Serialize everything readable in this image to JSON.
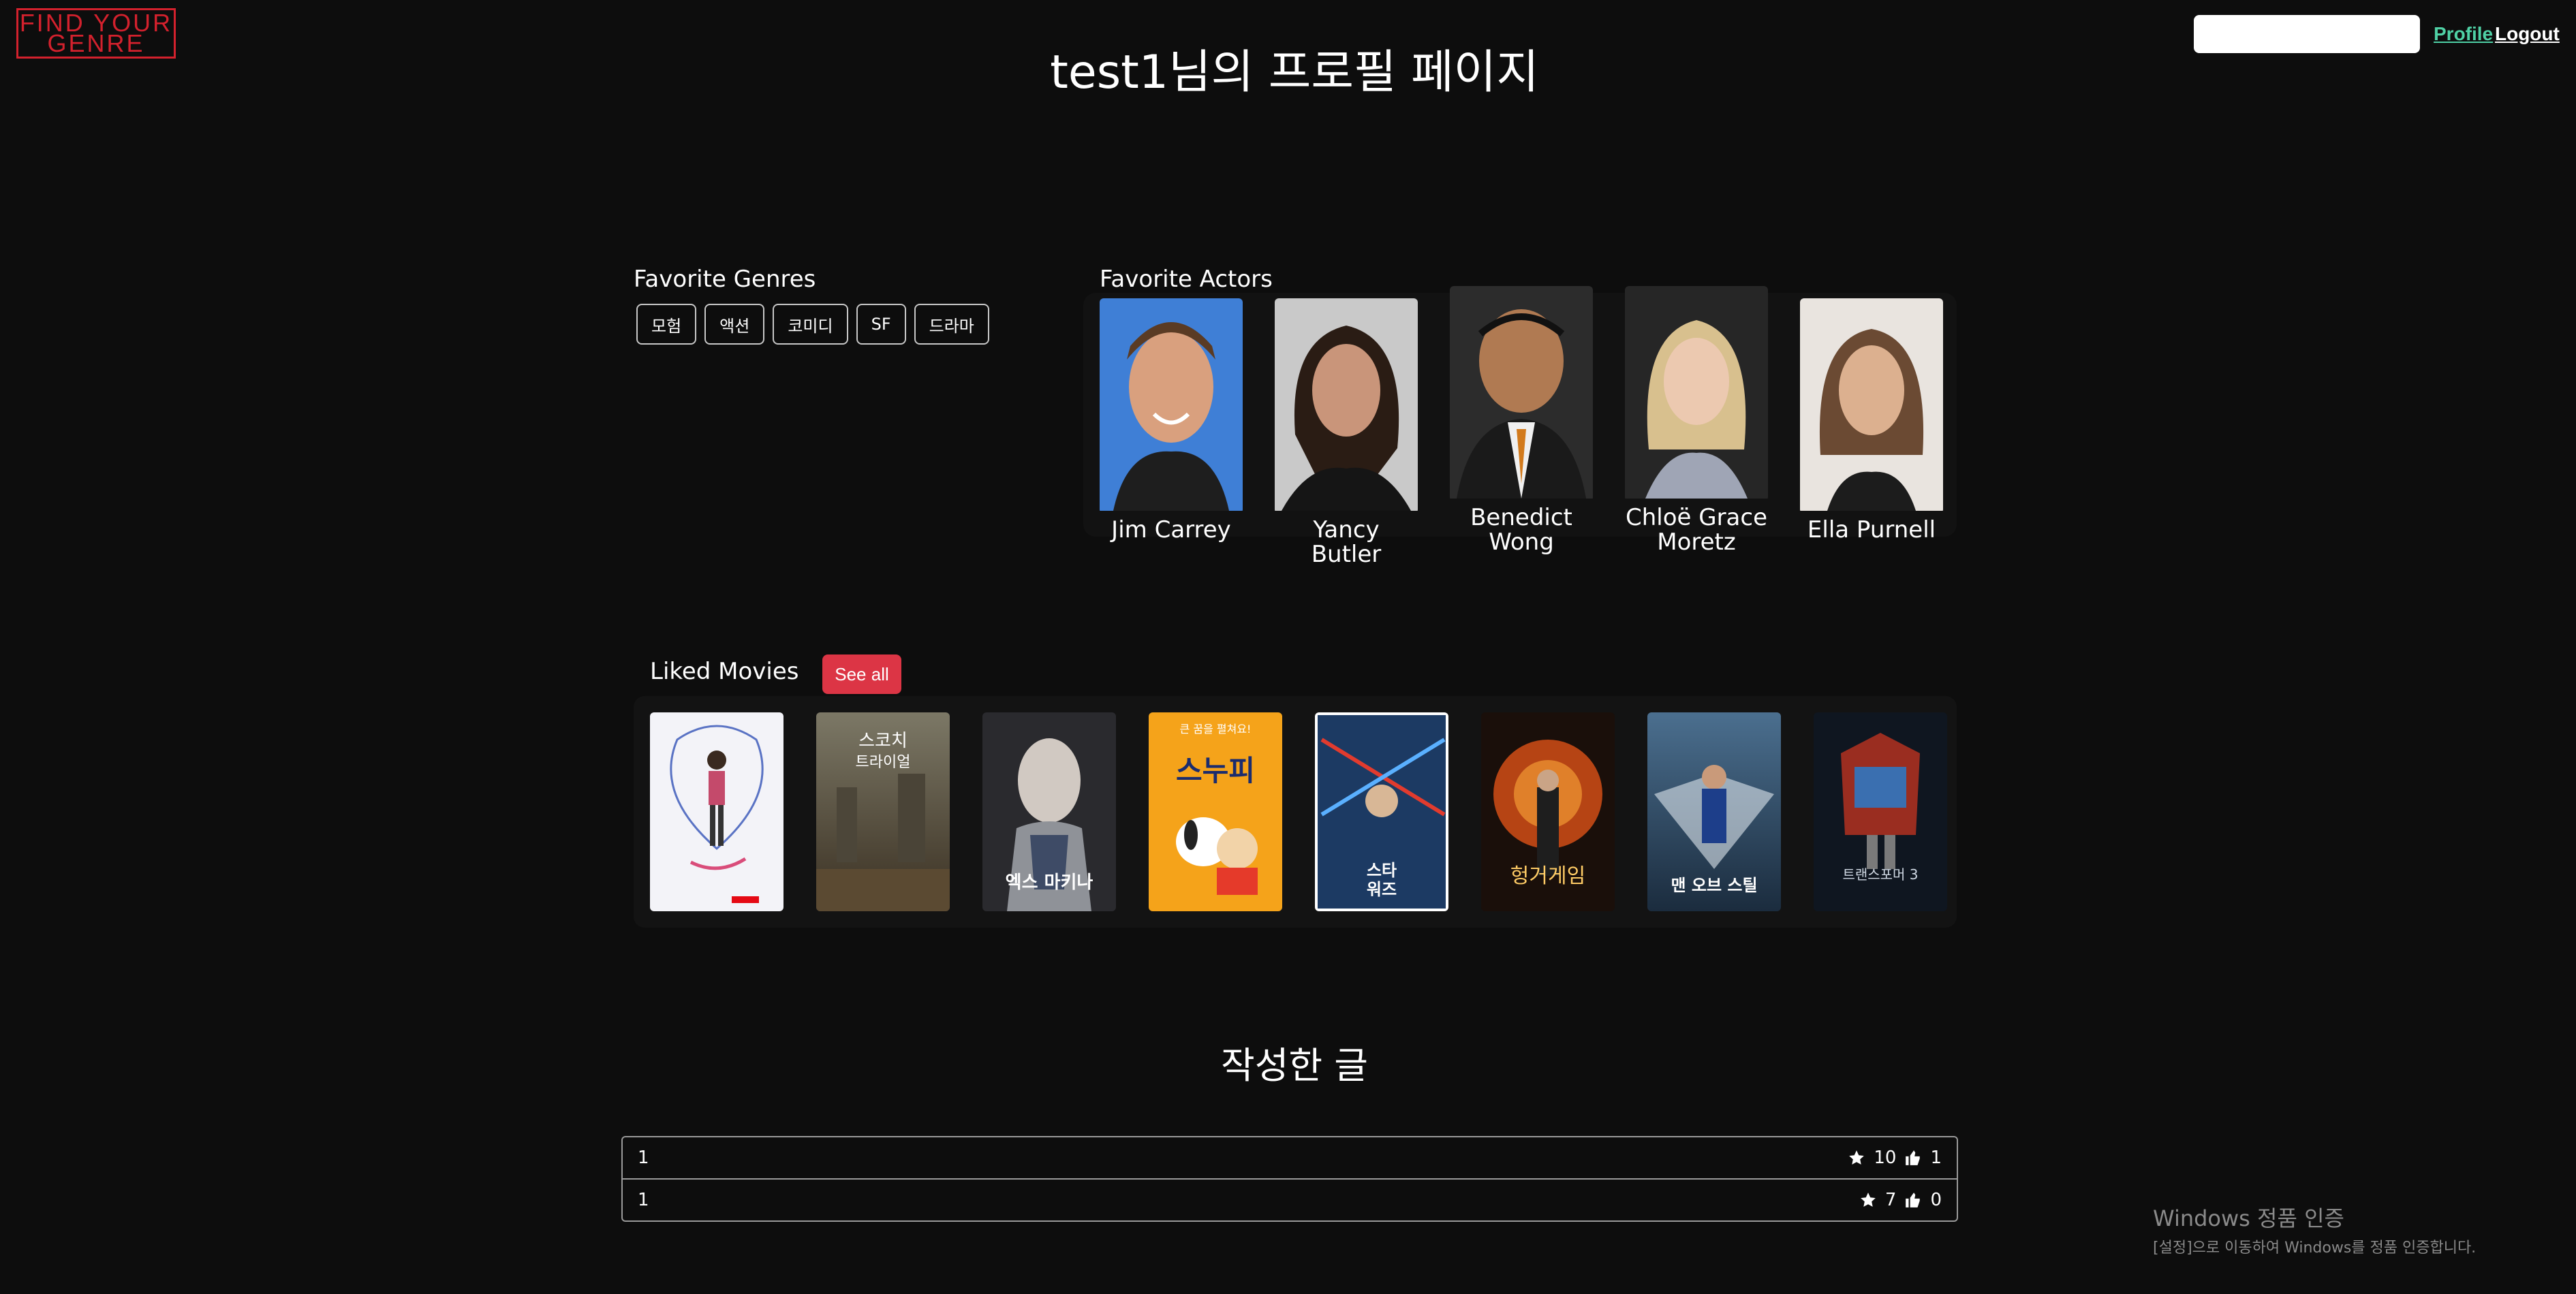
{
  "logo": {
    "line1": "FIND YOUR",
    "line2": "GENRE"
  },
  "nav": {
    "search_value": "",
    "profile": "Profile",
    "logout": "Logout"
  },
  "page_title": "test1님의 프로필 페이지",
  "favorite_genres": {
    "title": "Favorite Genres",
    "items": [
      "모험",
      "액션",
      "코미디",
      "SF",
      "드라마"
    ]
  },
  "favorite_actors": {
    "title": "Favorite Actors",
    "items": [
      {
        "name": "Jim Carrey"
      },
      {
        "name": "Yancy Butler"
      },
      {
        "name": "Benedict\nWong"
      },
      {
        "name": "Chloë Grace\nMoretz"
      },
      {
        "name": "Ella Purnell"
      }
    ]
  },
  "liked_movies": {
    "title": "Liked Movies",
    "see_all": "See all",
    "posters": [
      {
        "caption": ""
      },
      {
        "caption": "스코치 트라이얼"
      },
      {
        "caption": "엑스 마키나"
      },
      {
        "caption": "스누피"
      },
      {
        "caption": "스타워즈"
      },
      {
        "caption": "헝거게임"
      },
      {
        "caption": "맨 오브 스틸"
      },
      {
        "caption": "트랜스포머 3"
      }
    ]
  },
  "posts": {
    "title": "작성한 글",
    "rows": [
      {
        "title": "1",
        "rating": "10",
        "likes": "1"
      },
      {
        "title": "1",
        "rating": "7",
        "likes": "0"
      }
    ]
  },
  "watermark": {
    "line1": "Windows 정품 인증",
    "line2": "[설정]으로 이동하여 Windows를 정품 인증합니다."
  },
  "colors": {
    "accent_red": "#dc3545",
    "link_green": "#4fd1a5",
    "background": "#0d0d0d"
  }
}
